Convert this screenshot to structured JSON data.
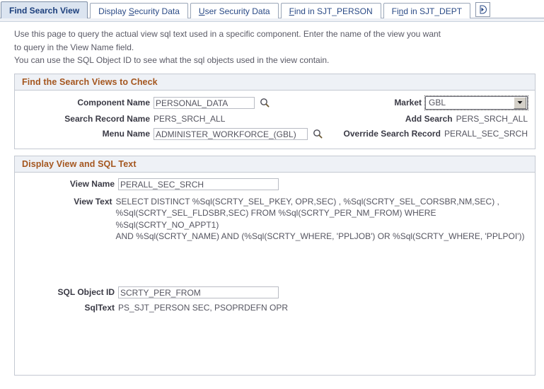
{
  "tabs": [
    {
      "label": "Find Search View",
      "accel": "",
      "active": true
    },
    {
      "label": "Display Security Data",
      "accel": "S",
      "active": false
    },
    {
      "label": "User Security Data",
      "accel": "U",
      "active": false
    },
    {
      "label": "Find in SJT_PERSON",
      "accel": "F",
      "active": false
    },
    {
      "label": "Find in SJT_DEPT",
      "accel": "n",
      "active": false
    }
  ],
  "tab_next_icon": "next-tabs-arrow-icon",
  "instructions": {
    "line1": "Use this page to query the actual view sql text used in a specific component. Enter the name of the view you want",
    "line2": "to query in the View Name field.",
    "line3": "You can use the SQL Object ID to see what the sql objects used in the view contain."
  },
  "find_panel": {
    "title": "Find the Search Views to Check",
    "component_name": {
      "label": "Component Name",
      "value": "PERSONAL_DATA"
    },
    "market": {
      "label": "Market",
      "value": "GBL"
    },
    "search_record_name": {
      "label": "Search Record Name",
      "value": "PERS_SRCH_ALL"
    },
    "add_search": {
      "label": "Add Search",
      "value": "PERS_SRCH_ALL"
    },
    "menu_name": {
      "label": "Menu Name",
      "value": "ADMINISTER_WORKFORCE_(GBL)"
    },
    "override_search_record": {
      "label": "Override Search Record",
      "value": "PERALL_SEC_SRCH"
    },
    "lookup_icon": "magnifier-lookup-icon"
  },
  "display_panel": {
    "title": "Display View and SQL Text",
    "view_name": {
      "label": "View Name",
      "value": "PERALL_SEC_SRCH"
    },
    "view_text": {
      "label": "View Text",
      "value": "SELECT DISTINCT %Sql(SCRTY_SEL_PKEY, OPR,SEC) , %Sql(SCRTY_SEL_CORSBR,NM,SEC) ,\n%Sql(SCRTY_SEL_FLDSBR,SEC) FROM %Sql(SCRTY_PER_NM_FROM) WHERE %Sql(SCRTY_NO_APPT1)\nAND %Sql(SCRTY_NAME) AND (%Sql(SCRTY_WHERE, 'PPLJOB') OR %Sql(SCRTY_WHERE, 'PPLPOI'))"
    },
    "sql_object_id": {
      "label": "SQL Object ID",
      "value": "SCRTY_PER_FROM"
    },
    "sql_text": {
      "label": "SqlText",
      "value": "PS_SJT_PERSON SEC, PSOPRDEFN OPR"
    }
  },
  "colors": {
    "header_text": "#a4561f",
    "header_bg": "#eef1f6",
    "tab_active_bg": "#dbe4f0",
    "tab_link": "#2a4a86",
    "field_text": "#555560"
  }
}
